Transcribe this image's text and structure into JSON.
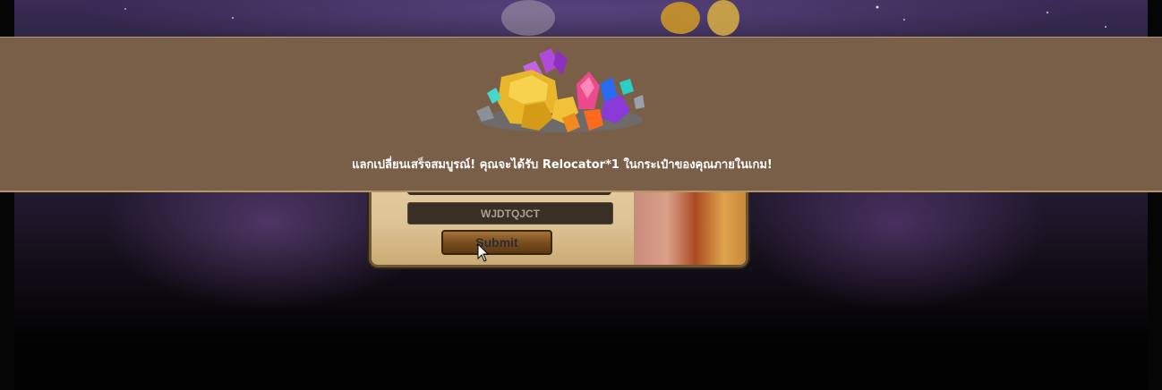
{
  "redeem_form": {
    "code_value": "WJDTQJCT",
    "submit_label": "Submit"
  },
  "toast": {
    "message": "แลกเปลี่ยนเสร็จสมบูรณ์! คุณจะได้รับ Relocator*1 ในกระเป๋าของคุณภายในเกม!",
    "reward_icon": "gem-pile-icon"
  },
  "colors": {
    "banner_background": "#7a5f48",
    "banner_border": "#b59662",
    "panel_background": "#e9d6ae",
    "button_background": "#7a4f1e",
    "input_background": "#3a2f25"
  }
}
